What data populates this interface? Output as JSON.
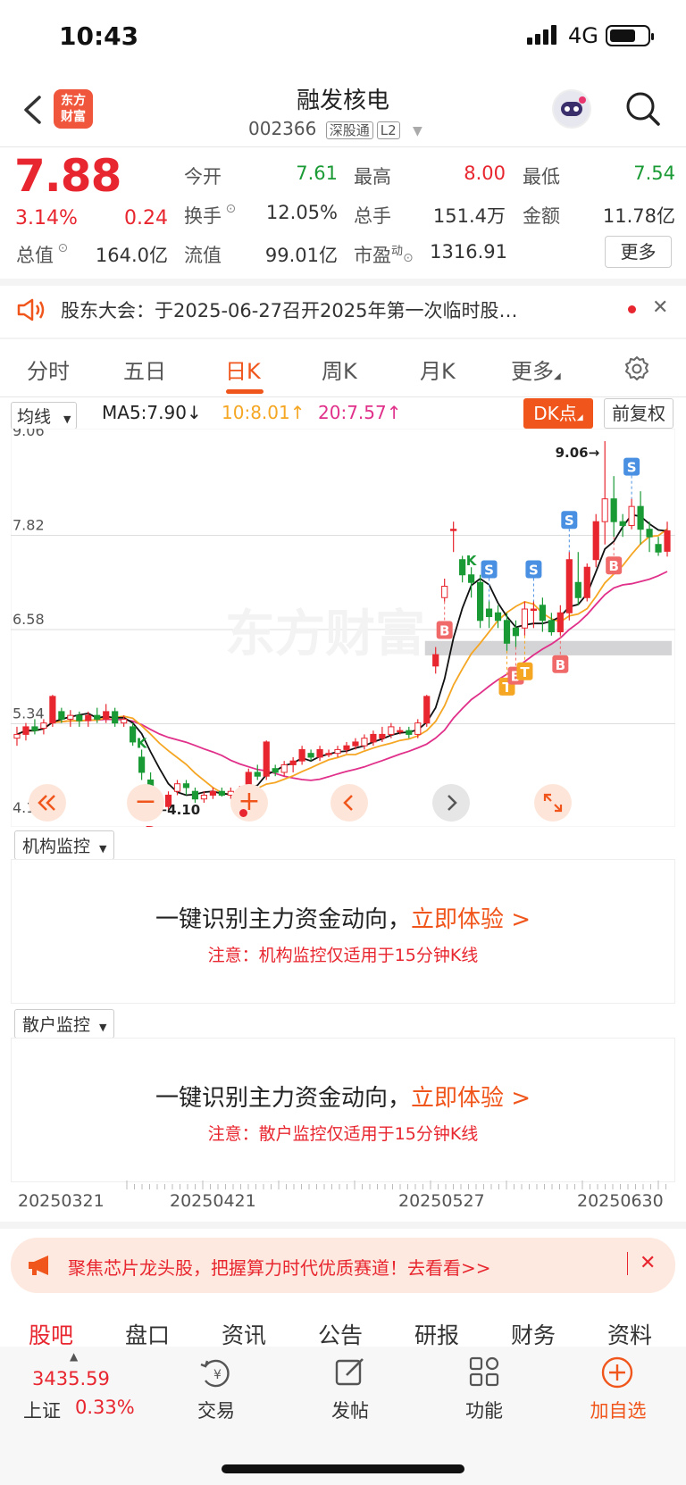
{
  "status": {
    "time": "10:43",
    "network": "4G"
  },
  "header": {
    "logo_line1": "东方",
    "logo_line2": "财富",
    "stock_name": "融发核电",
    "stock_code": "002366",
    "tag_connect": "深股通",
    "tag_level": "L2"
  },
  "quote": {
    "price": "7.88",
    "change_pct": "3.14%",
    "change_amt": "0.24",
    "open_label": "今开",
    "open": "7.61",
    "high_label": "最高",
    "high": "8.00",
    "low_label": "最低",
    "low": "7.54",
    "turnover_label": "换手",
    "turnover": "12.05%",
    "volume_label": "总手",
    "volume": "151.4万",
    "amount_label": "金额",
    "amount": "11.78亿",
    "mktcap_label": "总值",
    "mktcap": "164.0亿",
    "float_label": "流值",
    "float": "99.01亿",
    "pe_label": "市盈",
    "pe_sup": "动",
    "pe": "1316.91",
    "more_label": "更多"
  },
  "notice": {
    "text": "股东大会：于2025-06-27召开2025年第一次临时股…"
  },
  "tabs": [
    {
      "label": "分时"
    },
    {
      "label": "五日"
    },
    {
      "label": "日K"
    },
    {
      "label": "周K"
    },
    {
      "label": "月K"
    },
    {
      "label": "更多"
    }
  ],
  "ma": {
    "select": "均线",
    "ma5": "MA5:7.90",
    "ma5_arrow": "↓",
    "ma10": "10:8.01",
    "ma10_arrow": "↑",
    "ma20": "20:7.57",
    "ma20_arrow": "↑",
    "dk": "DK点",
    "adjust": "前复权"
  },
  "chart_data": {
    "type": "candlestick",
    "y_axis_labels": [
      "9.06",
      "7.82",
      "6.58",
      "5.34",
      "4.10"
    ],
    "ylim": [
      4.1,
      9.06
    ],
    "x_labels": [
      "20250321",
      "20250421",
      "20250527",
      "20250630"
    ],
    "max_marker": "9.06",
    "min_marker": "4.10",
    "watermark": "东方财富",
    "colors": {
      "up": "#e8262f",
      "down": "#1a9a34",
      "ma5": "#111111",
      "ma10": "#f5a623",
      "ma20": "#e0308a"
    },
    "candles": [
      [
        5.15,
        5.2,
        5.05,
        5.3
      ],
      [
        5.2,
        5.3,
        5.12,
        5.35
      ],
      [
        5.3,
        5.25,
        5.2,
        5.4
      ],
      [
        5.28,
        5.35,
        5.2,
        5.4
      ],
      [
        5.35,
        5.7,
        5.3,
        5.72
      ],
      [
        5.5,
        5.4,
        5.35,
        5.55
      ],
      [
        5.4,
        5.45,
        5.3,
        5.52
      ],
      [
        5.45,
        5.38,
        5.3,
        5.5
      ],
      [
        5.38,
        5.45,
        5.3,
        5.5
      ],
      [
        5.45,
        5.4,
        5.35,
        5.55
      ],
      [
        5.4,
        5.5,
        5.35,
        5.6
      ],
      [
        5.5,
        5.35,
        5.3,
        5.55
      ],
      [
        5.35,
        5.4,
        5.3,
        5.45
      ],
      [
        5.3,
        5.1,
        5.05,
        5.35
      ],
      [
        4.9,
        4.7,
        4.6,
        5.0
      ],
      [
        4.6,
        4.3,
        4.1,
        4.7
      ],
      [
        4.35,
        4.25,
        4.15,
        4.4
      ],
      [
        4.25,
        4.4,
        4.2,
        4.45
      ],
      [
        4.45,
        4.55,
        4.4,
        4.6
      ],
      [
        4.55,
        4.5,
        4.4,
        4.6
      ],
      [
        4.45,
        4.35,
        4.3,
        4.5
      ],
      [
        4.35,
        4.4,
        4.3,
        4.45
      ],
      [
        4.4,
        4.45,
        4.35,
        4.5
      ],
      [
        4.45,
        4.4,
        4.38,
        4.5
      ],
      [
        4.4,
        4.45,
        4.35,
        4.5
      ],
      [
        4.45,
        4.45,
        4.4,
        4.52
      ],
      [
        4.5,
        4.7,
        4.45,
        4.75
      ],
      [
        4.7,
        4.65,
        4.6,
        4.8
      ],
      [
        4.65,
        5.1,
        4.6,
        5.12
      ],
      [
        4.75,
        4.7,
        4.65,
        4.8
      ],
      [
        4.7,
        4.8,
        4.65,
        4.85
      ],
      [
        4.8,
        4.85,
        4.7,
        4.9
      ],
      [
        4.85,
        5.0,
        4.8,
        5.05
      ],
      [
        4.95,
        4.9,
        4.85,
        5.0
      ],
      [
        4.9,
        5.0,
        4.85,
        5.05
      ],
      [
        4.95,
        4.95,
        4.9,
        5.0
      ],
      [
        4.95,
        5.0,
        4.9,
        5.05
      ],
      [
        5.0,
        5.05,
        4.95,
        5.1
      ],
      [
        5.05,
        5.1,
        5.0,
        5.15
      ],
      [
        5.05,
        5.15,
        5.0,
        5.2
      ],
      [
        5.1,
        5.2,
        5.05,
        5.25
      ],
      [
        5.15,
        5.2,
        5.1,
        5.3
      ],
      [
        5.2,
        5.3,
        5.15,
        5.35
      ],
      [
        5.25,
        5.25,
        5.2,
        5.3
      ],
      [
        5.25,
        5.2,
        5.15,
        5.3
      ],
      [
        5.2,
        5.35,
        5.15,
        5.4
      ],
      [
        5.35,
        5.7,
        5.3,
        5.72
      ],
      [
        6.1,
        6.25,
        6.0,
        6.35
      ],
      [
        7.0,
        7.15,
        6.95,
        7.25
      ],
      [
        7.9,
        7.9,
        7.6,
        8.0
      ],
      [
        7.5,
        7.3,
        7.2,
        7.55
      ],
      [
        7.3,
        7.2,
        7.0,
        7.4
      ],
      [
        7.2,
        6.7,
        6.6,
        7.3
      ],
      [
        6.85,
        6.75,
        6.6,
        6.95
      ],
      [
        6.8,
        6.7,
        6.6,
        6.9
      ],
      [
        6.7,
        6.4,
        6.3,
        6.8
      ],
      [
        6.6,
        6.5,
        6.35,
        6.7
      ],
      [
        6.6,
        6.85,
        6.5,
        6.95
      ],
      [
        6.85,
        6.85,
        6.6,
        6.95
      ],
      [
        6.9,
        6.7,
        6.55,
        7.0
      ],
      [
        6.7,
        6.55,
        6.5,
        6.8
      ],
      [
        6.55,
        6.8,
        6.5,
        6.9
      ],
      [
        6.8,
        7.5,
        6.7,
        7.6
      ],
      [
        7.2,
        7.0,
        6.9,
        7.6
      ],
      [
        7.0,
        7.4,
        6.95,
        7.45
      ],
      [
        7.5,
        8.0,
        7.4,
        8.1
      ],
      [
        8.0,
        8.3,
        7.7,
        9.06
      ],
      [
        8.3,
        8.0,
        7.8,
        8.6
      ],
      [
        8.0,
        7.95,
        7.8,
        8.1
      ],
      [
        7.95,
        8.2,
        7.9,
        8.3
      ],
      [
        8.2,
        7.9,
        7.7,
        8.4
      ],
      [
        7.9,
        7.8,
        7.6,
        8.0
      ],
      [
        7.7,
        7.6,
        7.55,
        7.8
      ],
      [
        7.61,
        7.88,
        7.54,
        8.0
      ]
    ],
    "signals": [
      {
        "i": 14,
        "t": "K"
      },
      {
        "i": 15,
        "t": "D"
      },
      {
        "i": 48,
        "t": "B"
      },
      {
        "i": 51,
        "t": "K"
      },
      {
        "i": 53,
        "t": "S"
      },
      {
        "i": 55,
        "t": "T"
      },
      {
        "i": 56,
        "t": "B"
      },
      {
        "i": 57,
        "t": "T"
      },
      {
        "i": 58,
        "t": "S"
      },
      {
        "i": 61,
        "t": "B"
      },
      {
        "i": 62,
        "t": "S"
      },
      {
        "i": 67,
        "t": "B"
      },
      {
        "i": 69,
        "t": "S"
      }
    ]
  },
  "chart_nav": {
    "dash": "−",
    "plus": "+"
  },
  "panels": [
    {
      "label": "机构监控",
      "title": "一键识别主力资金动向，",
      "cta": "立即体验 >",
      "note": "注意：机构监控仅适用于15分钟K线"
    },
    {
      "label": "散户监控",
      "title": "一键识别主力资金动向，",
      "cta": "立即体验 >",
      "note": "注意：散户监控仅适用于15分钟K线"
    }
  ],
  "banner": {
    "text": "聚焦芯片龙头股，把握算力时代优质赛道！去看看>>"
  },
  "subtabs": [
    {
      "label": "股吧"
    },
    {
      "label": "盘口"
    },
    {
      "label": "资讯"
    },
    {
      "label": "公告"
    },
    {
      "label": "研报"
    },
    {
      "label": "财务"
    },
    {
      "label": "资料"
    }
  ],
  "bottom": {
    "index_value": "3435.59",
    "index_name": "上证",
    "index_change": "0.33%",
    "trade": "交易",
    "post": "发帖",
    "func": "功能",
    "add": "加自选"
  }
}
